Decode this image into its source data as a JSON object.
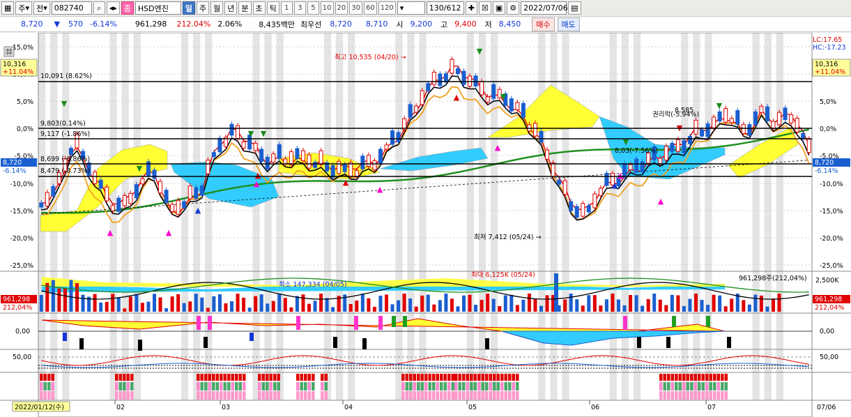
{
  "toolbar": {
    "period_type": "주",
    "market": "전",
    "code": "082740",
    "badge": "종",
    "stock_name": "HSD엔진",
    "interval_day": "일",
    "interval_week": "주",
    "interval_month": "월",
    "interval_year": "년",
    "interval_min": "분",
    "interval_sec": "초",
    "interval_tick": "틱",
    "num_buttons": [
      "1",
      "3",
      "5",
      "10",
      "20",
      "30",
      "60",
      "120"
    ],
    "count": "130/612",
    "date": "2022/07/06"
  },
  "quote": {
    "price": "8,720",
    "change": "570",
    "change_pct": "-6.14%",
    "volume": "961,298",
    "volume_ratio": "212.04%",
    "turnover": "2.06%",
    "amount": "8,435백만",
    "best_ask_label": "최우선",
    "best_ask": "8,720",
    "best_bid": "8,710",
    "open_label": "시",
    "open": "9,200",
    "high_label": "고",
    "high": "9,400",
    "low_label": "저",
    "low": "8,450",
    "buy_label": "매수",
    "sell_label": "매도"
  },
  "chart_text": {
    "lc": "LC:17.65",
    "hc": "HC:-17.23",
    "line_high_pct": "10,091 (8.62%)",
    "line_a": "9,803(0.14%)",
    "line_b": "9,117 (-1.86%)",
    "line_c": "8,699 (-6.86%)",
    "line_d": "8,479 (-8.73%)",
    "box_top_price": "10,316",
    "box_top_pct": "+11.04%",
    "box_cur_price": "8,720",
    "box_cur_pct": "-6.14%",
    "high_note": "최고 10,535 (04/20) →",
    "low_note": "최저 7,412 (05/24) →",
    "rights_note": "권리락(-5.94%)",
    "mid_note": "8,03(-7.56%)",
    "max_note_top": "8,585",
    "vol_min_note": "최소 147,334 (04/05)",
    "vol_max_note": "최대 6,125K (05/24)",
    "vol_current": "961,298주(212,04%)",
    "vol_box_value": "961,298",
    "vol_box_pct": "212,04%",
    "vol_axis": "2,500K",
    "macd_zero": "0,00",
    "stoch_50": "50,00",
    "start_date": "2022/01/12(수)",
    "end_date": "07/06",
    "price_ticks": [
      "15,0%",
      "10,0%",
      "5,0%",
      "0,0%",
      "-5,0%",
      "-10,0%",
      "-15,0%",
      "-20,0%",
      "-25,0%"
    ],
    "right_ticks": [
      "5,0%",
      "0,0%",
      "-5,0%",
      "-10,0%",
      "-15,0%",
      "-20,0%",
      "-25,0%"
    ],
    "months": [
      "02",
      "03",
      "04",
      "05",
      "06",
      "07"
    ]
  },
  "colors": {
    "up": "#e00000",
    "down": "#1a5fd0",
    "ichimoku_yellow": "#ffff33",
    "ichimoku_cyan": "#33ccff",
    "ma_green": "#1f8f1f",
    "ma_orange": "#f0a020"
  }
}
